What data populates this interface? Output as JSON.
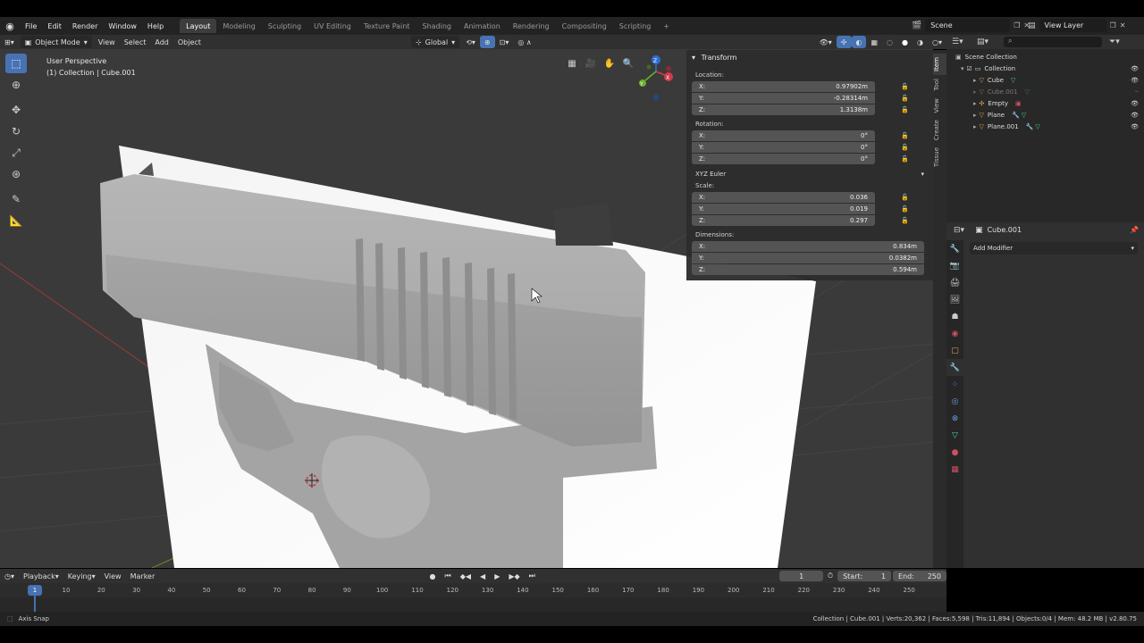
{
  "topbar": {
    "menus": [
      "File",
      "Edit",
      "Render",
      "Window",
      "Help"
    ],
    "workspaces": [
      "Layout",
      "Modeling",
      "Sculpting",
      "UV Editing",
      "Texture Paint",
      "Shading",
      "Animation",
      "Rendering",
      "Compositing",
      "Scripting"
    ],
    "active_workspace": "Layout",
    "add_tab": "+",
    "scene": "Scene",
    "view_layer": "View Layer"
  },
  "header3d": {
    "mode": "Object Mode",
    "menus": [
      "View",
      "Select",
      "Add",
      "Object"
    ],
    "orientation": "Global"
  },
  "viewport": {
    "view_name": "User Perspective",
    "collection_info": "(1) Collection | Cube.001"
  },
  "gizmo": {
    "x": "X",
    "y": "Y",
    "z": "Z"
  },
  "npanel": {
    "tabs": [
      "Item",
      "Tool",
      "View",
      "Create",
      "Tissue"
    ],
    "title": "Transform",
    "location_label": "Location:",
    "location": [
      {
        "axis": "X:",
        "value": "0.97902m"
      },
      {
        "axis": "Y:",
        "value": "-0.28314m"
      },
      {
        "axis": "Z:",
        "value": "1.3138m"
      }
    ],
    "rotation_label": "Rotation:",
    "rotation": [
      {
        "axis": "X:",
        "value": "0°"
      },
      {
        "axis": "Y:",
        "value": "0°"
      },
      {
        "axis": "Z:",
        "value": "0°"
      }
    ],
    "rotation_mode": "XYZ Euler",
    "scale_label": "Scale:",
    "scale": [
      {
        "axis": "X:",
        "value": "0.036"
      },
      {
        "axis": "Y:",
        "value": "0.019"
      },
      {
        "axis": "Z:",
        "value": "0.297"
      }
    ],
    "dimensions_label": "Dimensions:",
    "dimensions": [
      {
        "axis": "X:",
        "value": "0.834m"
      },
      {
        "axis": "Y:",
        "value": "0.0382m"
      },
      {
        "axis": "Z:",
        "value": "0.594m"
      }
    ]
  },
  "outliner": {
    "scene_collection": "Scene Collection",
    "collection": "Collection",
    "items": [
      "Cube",
      "Cube.001",
      "Empty",
      "Plane",
      "Plane.001"
    ]
  },
  "properties": {
    "object_name": "Cube.001",
    "add_modifier": "Add Modifier"
  },
  "timeline": {
    "menus": [
      "Playback",
      "Keying",
      "View",
      "Marker"
    ],
    "current_frame": "1",
    "start_label": "Start:",
    "start": "1",
    "end_label": "End:",
    "end": "250",
    "ticks": [
      "1",
      "10",
      "20",
      "30",
      "40",
      "50",
      "60",
      "70",
      "80",
      "90",
      "100",
      "110",
      "120",
      "130",
      "140",
      "150",
      "160",
      "170",
      "180",
      "190",
      "200",
      "210",
      "220",
      "230",
      "240",
      "250"
    ]
  },
  "status": {
    "left": "Axis Snap",
    "right": "Collection | Cube.001 | Verts:20,362 | Faces:5,598 | Tris:11,894 | Objects:0/4 | Mem: 48.2 MB | v2.80.75"
  }
}
